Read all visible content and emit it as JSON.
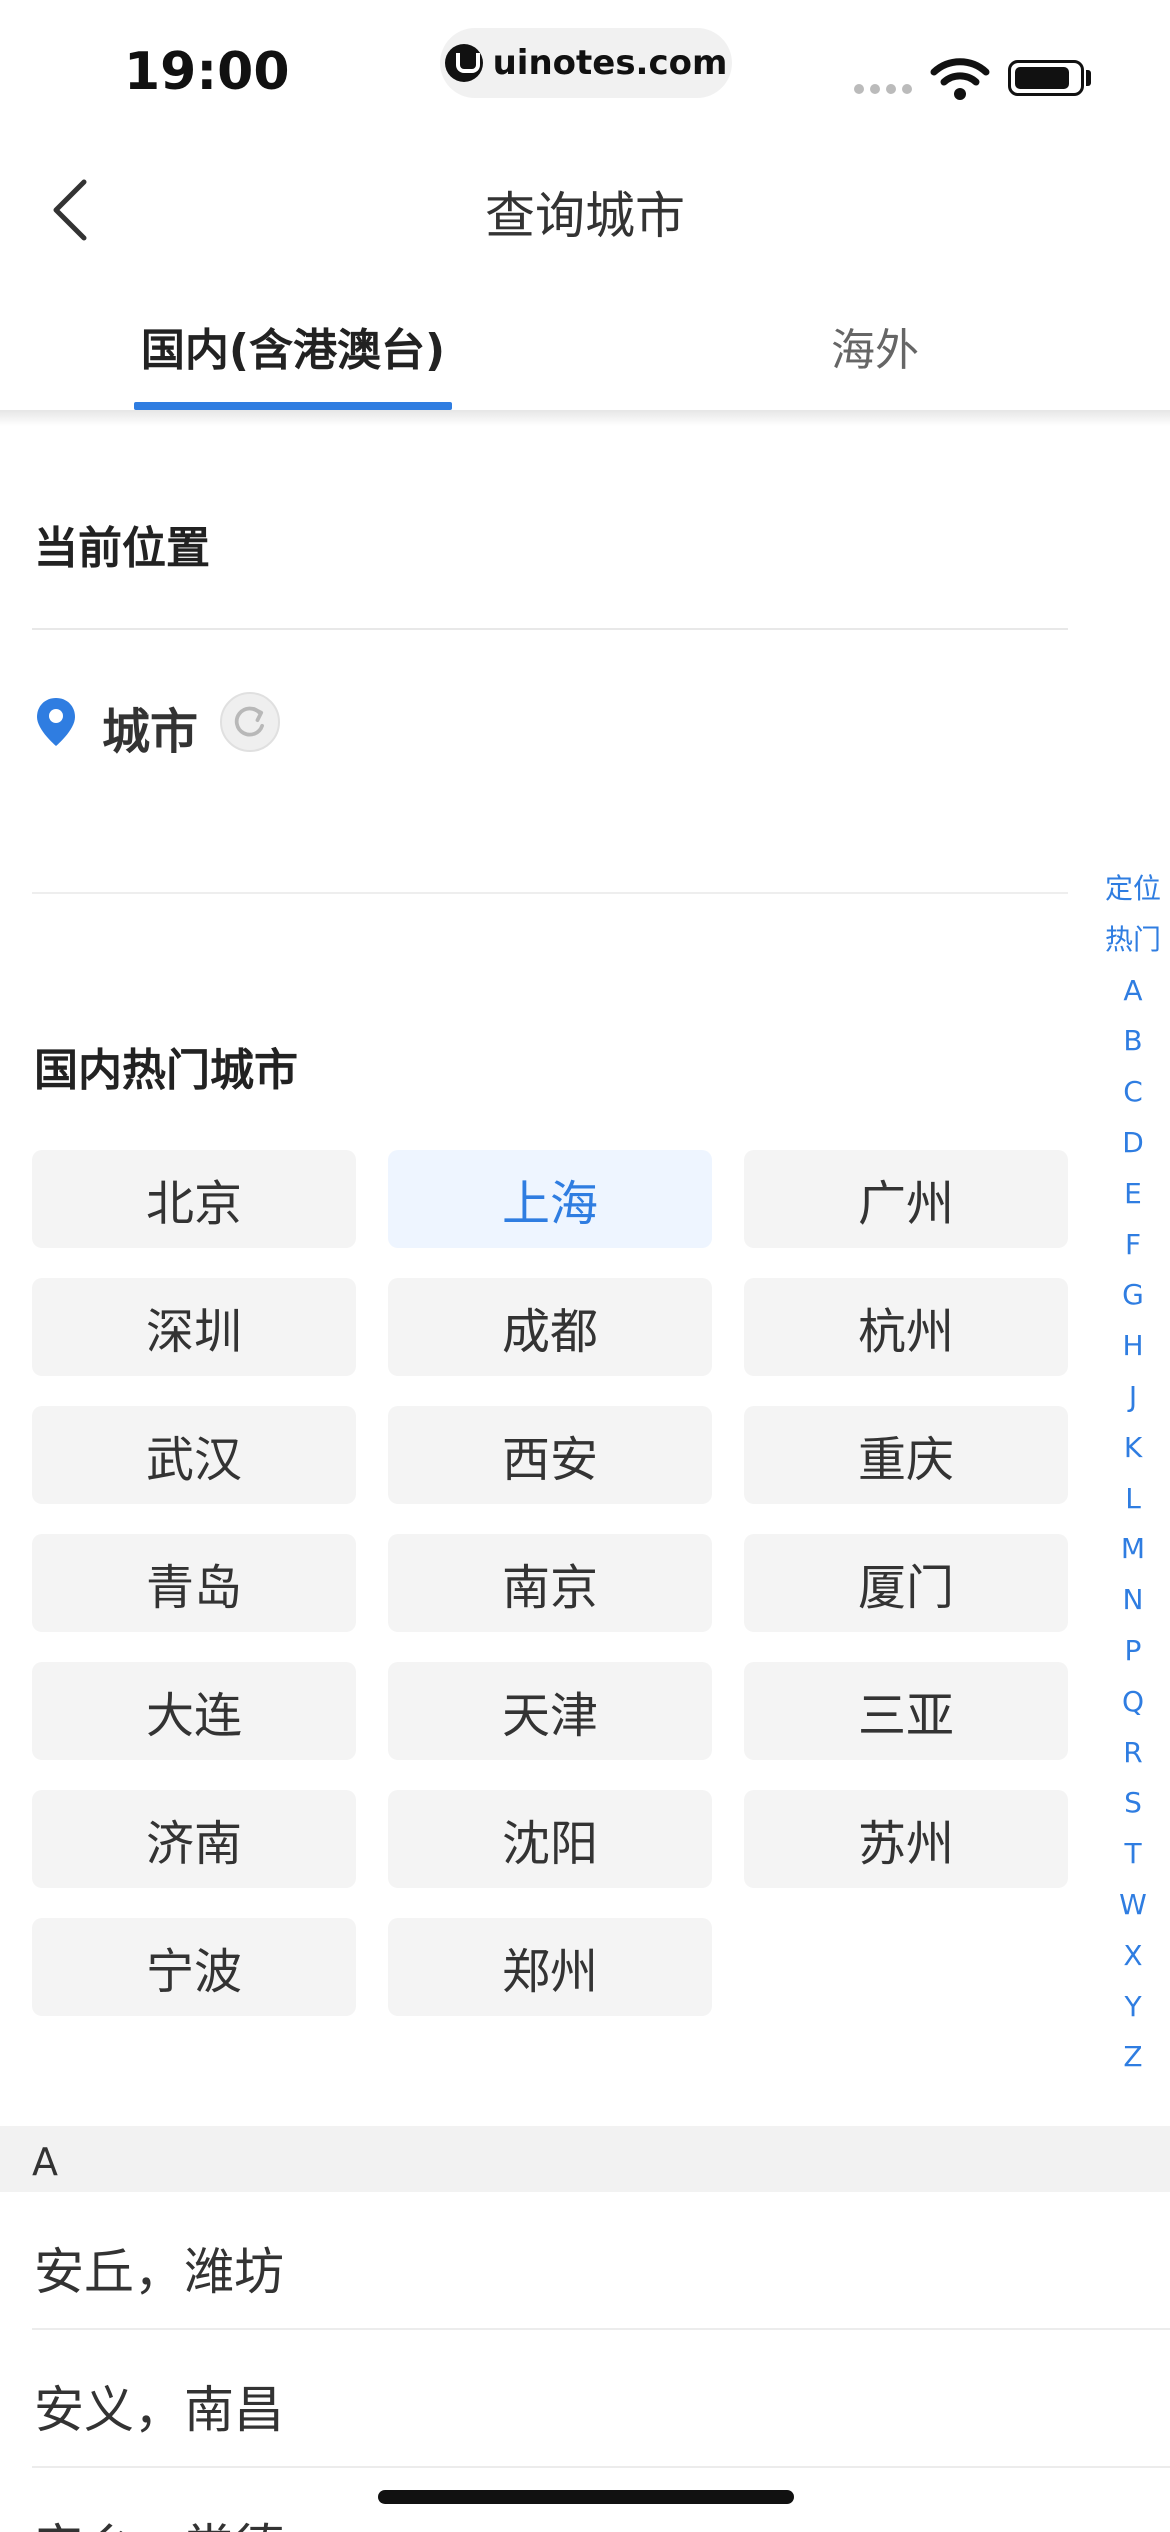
{
  "status_bar": {
    "time": "19:00",
    "url": "uinotes.com"
  },
  "header": {
    "title": "查询城市"
  },
  "tabs": [
    {
      "label": "国内(含港澳台)",
      "active": true
    },
    {
      "label": "海外",
      "active": false
    }
  ],
  "current_location": {
    "title": "当前位置",
    "city": "城市"
  },
  "hot_cities": {
    "title": "国内热门城市",
    "items": [
      "北京",
      "上海",
      "广州",
      "深圳",
      "成都",
      "杭州",
      "武汉",
      "西安",
      "重庆",
      "青岛",
      "南京",
      "厦门",
      "大连",
      "天津",
      "三亚",
      "济南",
      "沈阳",
      "苏州",
      "宁波",
      "郑州"
    ],
    "selected": "上海"
  },
  "index_bar": [
    "定位",
    "热门",
    "A",
    "B",
    "C",
    "D",
    "E",
    "F",
    "G",
    "H",
    "J",
    "K",
    "L",
    "M",
    "N",
    "P",
    "Q",
    "R",
    "S",
    "T",
    "W",
    "X",
    "Y",
    "Z"
  ],
  "city_list": {
    "letter": "A",
    "items": [
      "安丘，潍坊",
      "安义，南昌",
      "安乡，常德"
    ]
  },
  "colors": {
    "accent": "#2f7de1",
    "selected_bg": "#eef5ff",
    "button_bg": "#f4f4f4"
  }
}
